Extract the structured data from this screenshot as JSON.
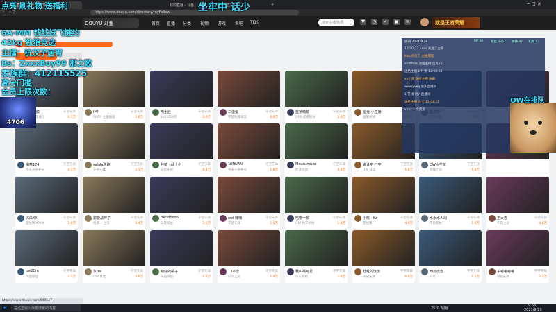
{
  "browser": {
    "tabs": [
      "斗鱼直播 - 关于斗鱼TV的直播",
      "我的直播 - 斗鱼",
      "直播列表",
      "+"
    ],
    "address": "https://www.douyu.com/directory/myFollow"
  },
  "header": {
    "logo_text": "DOUYU 斗鱼",
    "nav": [
      "首页",
      "直播",
      "分类",
      "视频",
      "游戏",
      "鱼吧",
      "TI10"
    ],
    "search_placeholder": "搜索主播/房间",
    "icons": [
      "关注",
      "历史",
      "任务",
      "客户端",
      "消息"
    ],
    "game_banner": "就是王者荣耀"
  },
  "overlays": {
    "top_left": "点亮 刷礼物 送福利",
    "top_center": "坐牢中 话少",
    "lines": [
      "6A-MM 钱钱妖飞链约",
      "42kg 独狼竞选",
      "主播：杭汉子居胃",
      "Bs：ZxxxBoy99 那之歌",
      "家族群：412115525",
      "高分门槛",
      "会员上限次数："
    ],
    "badge_number": "4706",
    "dog_text": "OW在排队"
  },
  "chat": {
    "header": "房间 2021.9.29",
    "stats": [
      "RP 38",
      "粉丝 3257",
      "弹幕 47",
      "礼物 12"
    ],
    "lines": [
      "12:50:22 xxxx 关注了主播",
      "kou 点亮了 主播成就",
      "asdffxxx 送给主播 鱼丸x1",
      "送给主播 1个 赞 13:04:03",
      "xx小天 送给主播 弹幕",
      "wxwqewq 进入直播间",
      "1 在线 进入直播间",
      "送给主播 办卡 13:04:21",
      "xxxx 1 个贵族"
    ]
  },
  "cards": [
    {
      "name": "清夜朦朦",
      "title": "OW 日常排位",
      "heat": "1.7万",
      "tag": "守望先锋"
    },
    {
      "name": "jiaJi",
      "title": "PONY 主播成就",
      "heat": "1.6万",
      "tag": "守望先锋"
    },
    {
      "name": "陶土匠",
      "title": "2021年9月",
      "heat": "2.9万",
      "tag": "守望先锋"
    },
    {
      "name": "二蛋蛋",
      "title": "守望先锋日常",
      "heat": "6.6万",
      "tag": "守望先锋"
    },
    {
      "name": "蓝桥萌萌",
      "title": "DPS 双倍积分",
      "heat": "5.4万",
      "tag": "守望先锋"
    },
    {
      "name": "星光 小主播",
      "title": "国服天梯",
      "heat": "12.8万",
      "tag": "守望先锋"
    },
    {
      "name": "蓝蓝吧",
      "title": "日常练枪",
      "heat": "3.3万",
      "tag": "守望先锋"
    },
    {
      "name": "",
      "title": "",
      "heat": "",
      "tag": ""
    },
    {
      "name": "海燕174",
      "title": "今天双倍积分",
      "heat": "4.1万",
      "tag": "守望先锋"
    },
    {
      "name": "salala跑跑",
      "title": "守望先锋",
      "heat": "2.1万",
      "tag": "守望先锋"
    },
    {
      "name": "胖萌 · 战士小",
      "title": "斗鱼守望",
      "heat": "8.3万",
      "tag": "守望先锋"
    },
    {
      "name": "1ENNAN",
      "title": "今天十倍积分",
      "heat": "1.6万",
      "tag": "守望先锋"
    },
    {
      "name": "Mousumuzz",
      "title": "枪法挑战",
      "heat": "4.0万",
      "tag": "守望先锋"
    },
    {
      "name": "说说吧 打字",
      "title": "OW 日常",
      "heat": "1.8万",
      "tag": "守望先锋"
    },
    {
      "name": "OW木兰花",
      "title": "双排上分",
      "heat": "1.6万",
      "tag": "守望先锋"
    },
    {
      "name": "",
      "title": "",
      "heat": "",
      "tag": ""
    },
    {
      "name": "沐风XX",
      "title": "定位赛冲冲冲",
      "heat": "3.0万",
      "tag": "守望先锋"
    },
    {
      "name": "碧旋战神子",
      "title": "星期一 上分",
      "heat": "8.4万",
      "tag": "守望先锋"
    },
    {
      "name": "BRSB5885",
      "title": "日常排位",
      "heat": "2.1万",
      "tag": "守望先锋"
    },
    {
      "name": "owl 嗨嗨",
      "title": "守望先锋",
      "heat": "1.5万",
      "tag": "守望先锋"
    },
    {
      "name": "吃吃一顿",
      "title": "OW 秒天秒地",
      "heat": "1.8万",
      "tag": "守望先锋"
    },
    {
      "name": "小桃 · Kz",
      "title": "定位赛",
      "heat": "4.0万",
      "tag": "守望先锋"
    },
    {
      "name": "水水水人周",
      "title": "午后练枪",
      "heat": "1.6万",
      "tag": "守望先锋"
    },
    {
      "name": "王大吉",
      "title": "午夜上分",
      "heat": "4.8万",
      "tag": "守望先锋"
    },
    {
      "name": "ow2Din",
      "title": "午后排位",
      "heat": "2.1万",
      "tag": "守望先锋"
    },
    {
      "name": "灰ow",
      "title": "OW 反话",
      "heat": "4.6万",
      "tag": "守望先锋"
    },
    {
      "name": "萌仔的橘子",
      "title": "午后排位",
      "heat": "1.3万",
      "tag": "守望先锋"
    },
    {
      "name": "13不念",
      "title": "日常上分",
      "heat": "1.4万",
      "tag": "守望先锋"
    },
    {
      "name": "我叫橘可爱",
      "title": "今天练枪",
      "heat": "1.9万",
      "tag": "守望先锋"
    },
    {
      "name": "蛙蛙的饭饭",
      "title": "守望先锋",
      "heat": "6.9万",
      "tag": "守望先锋"
    },
    {
      "name": "西瓜皮皮",
      "title": "日常",
      "heat": "1.1万",
      "tag": "守望先锋"
    },
    {
      "name": "子嘟嘟嘟嘟",
      "title": "守望先锋",
      "heat": "2.3万",
      "tag": "守望先锋"
    }
  ],
  "status_text": "https://www.douyu.com/940547",
  "taskbar": {
    "search": "在这里输入你要搜索的内容",
    "weather": "25°C 晴朗",
    "time": "9:56",
    "date": "2021/9/29"
  },
  "colors": {
    "accent": "#ff6a1a",
    "header": "#1e1e1e",
    "overlay_text": "#3fe0ff",
    "chat_bg": "#23375f"
  }
}
